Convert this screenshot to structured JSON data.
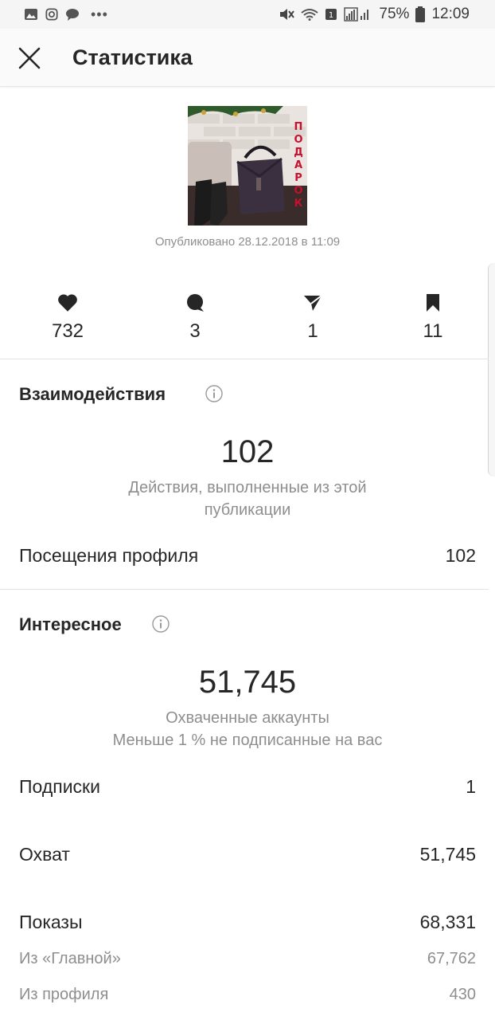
{
  "status_bar": {
    "battery": "75%",
    "time": "12:09",
    "icons": [
      "image-icon",
      "instagram-icon",
      "chat-icon",
      "more-dots-icon",
      "mute-icon",
      "wifi-icon",
      "sim-icon",
      "signal-icon",
      "battery-icon"
    ]
  },
  "header": {
    "title": "Статистика",
    "close_icon": "close-icon"
  },
  "post": {
    "image_overlay_text": "ПОДАРОК",
    "published": "Опубликовано 28.12.2018 в 11:09"
  },
  "metrics": [
    {
      "icon": "heart-icon",
      "value": "732"
    },
    {
      "icon": "comment-icon",
      "value": "3"
    },
    {
      "icon": "share-icon",
      "value": "1"
    },
    {
      "icon": "bookmark-icon",
      "value": "11"
    }
  ],
  "interactions": {
    "title": "Взаимодействия",
    "total": "102",
    "caption_line1": "Действия, выполненные из этой",
    "caption_line2": "публикации",
    "rows": [
      {
        "label": "Посещения профиля",
        "value": "102"
      }
    ]
  },
  "discovery": {
    "title": "Интересное",
    "total": "51,745",
    "caption_line1": "Охваченные аккаунты",
    "caption_line2": "Меньше 1 % не подписанные на вас",
    "rows": [
      {
        "label": "Подписки",
        "value": "1"
      },
      {
        "label": "Охват",
        "value": "51,745"
      },
      {
        "label": "Показы",
        "value": "68,331"
      }
    ],
    "sub_rows": [
      {
        "label": "Из «Главной»",
        "value": "67,762"
      },
      {
        "label": "Из профиля",
        "value": "430"
      }
    ]
  },
  "colors": {
    "text": "#262626",
    "secondary": "#8e8e8e",
    "overlay_red": "#c8102e"
  }
}
